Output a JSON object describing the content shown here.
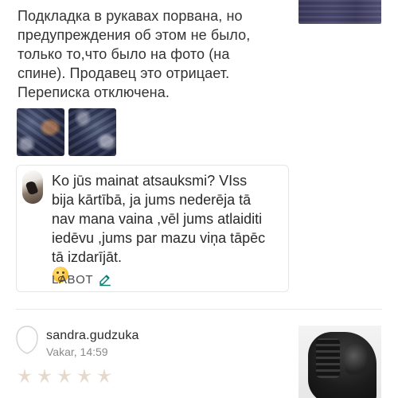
{
  "review": {
    "text_lines": [
      "Подкладка в рукавах порвана, но",
      "предупреждения об этом не было,",
      "только то,что было на фото (на",
      "спине). Продавец это отрицает.",
      "Переписка отключена."
    ]
  },
  "reply": {
    "text_lines": [
      "Ko jūs mainat atsauksmi? VIss",
      "bija kārtībā, ja jums nederēja tā",
      "nav mana vaina ,vēl jums atlaiditi",
      "iedēvu ,jums par mazu viņa tāpēc",
      "tā izdarījāt."
    ],
    "emoji_icon": "flushed-face-emoji",
    "edit_label": "LABOT",
    "accent_color": "#0a7f72"
  },
  "next_review": {
    "username": "sandra.gudzuka",
    "timestamp": "Vakar, 14:59",
    "rating": 0,
    "rating_max": 5,
    "star_color": "#e4d9cc"
  }
}
